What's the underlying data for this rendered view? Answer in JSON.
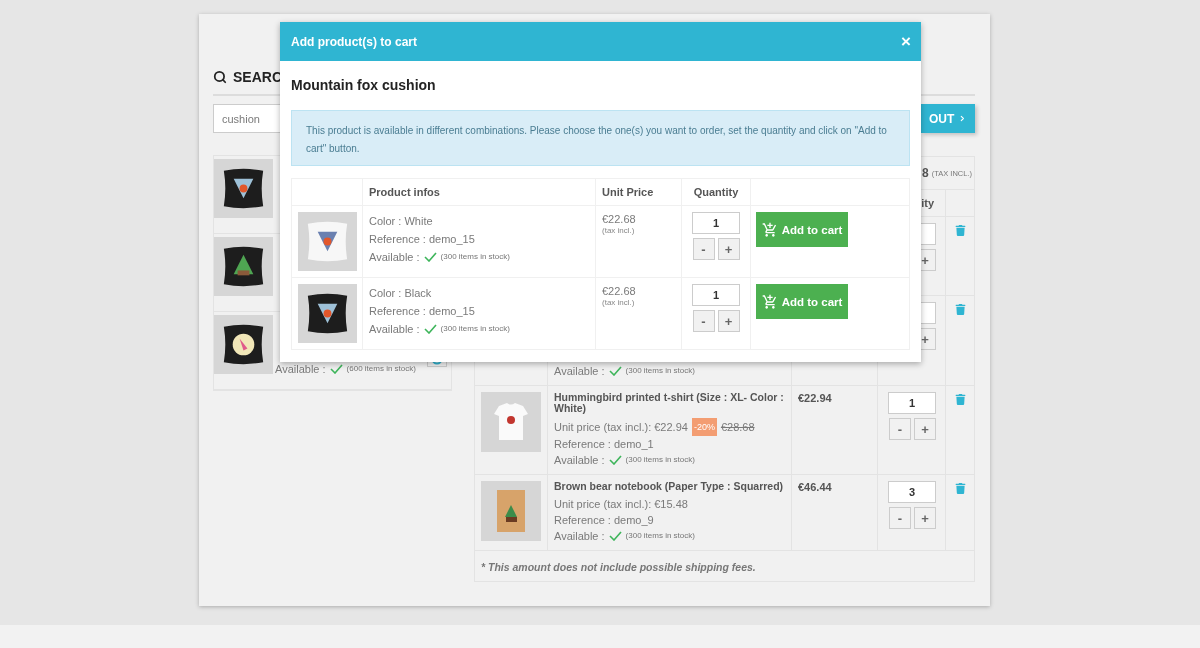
{
  "search": {
    "title": "SEARC",
    "query": "cushion"
  },
  "results": [
    {
      "kind": "covered"
    },
    {
      "kind": "covered"
    },
    {
      "kind": "stock",
      "available": "Available :",
      "stock": "(600 items in stock)"
    }
  ],
  "checkout": {
    "label": "OUT"
  },
  "cart": {
    "total": "8",
    "tax_note": "(TAX INCL.)",
    "qty_header": "ity",
    "rows": [
      {
        "kind": "covered",
        "plus": "+"
      },
      {
        "kind": "covered",
        "plus": "+",
        "available": "Available :",
        "stock": "(300 items in stock)"
      },
      {
        "kind": "full",
        "name": "Hummingbird printed t-shirt (Size : XL- Color : White)",
        "unit_price": "Unit price (tax incl.): €22.94",
        "discount": "-20%",
        "old_price": "€28.68",
        "reference": "Reference : demo_1",
        "available": "Available :",
        "stock": "(300 items in stock)",
        "total": "€22.94",
        "qty": "1",
        "minus": "-",
        "plus": "+"
      },
      {
        "kind": "full",
        "name": "Brown bear notebook (Paper Type : Squarred)",
        "unit_price": "Unit price (tax incl.): €15.48",
        "reference": "Reference : demo_9",
        "available": "Available :",
        "stock": "(300 items in stock)",
        "total": "€46.44",
        "qty": "3",
        "minus": "-",
        "plus": "+"
      }
    ],
    "note": "* This amount does not include possible shipping fees."
  },
  "modal": {
    "title": "Add product(s) to cart",
    "close": "×",
    "product": "Mountain fox cushion",
    "notice": "This product is available in different combinations. Please choose the one(s) you want to order, set the quantity and click on \"Add to cart\" button.",
    "columns": [
      "Product infos",
      "Unit Price",
      "Quantity"
    ],
    "combinations": [
      {
        "variant": "Color : White",
        "reference": "Reference : demo_15",
        "available": "Available :",
        "stock": "(300 items in stock)",
        "price": "€22.68",
        "tax": "(tax incl.)",
        "qty": "1",
        "minus": "-",
        "plus": "+",
        "button": "Add to cart"
      },
      {
        "variant": "Color : Black",
        "reference": "Reference : demo_15",
        "available": "Available :",
        "stock": "(300 items in stock)",
        "price": "€22.68",
        "tax": "(tax incl.)",
        "qty": "1",
        "minus": "-",
        "plus": "+",
        "button": "Add to cart"
      }
    ]
  }
}
